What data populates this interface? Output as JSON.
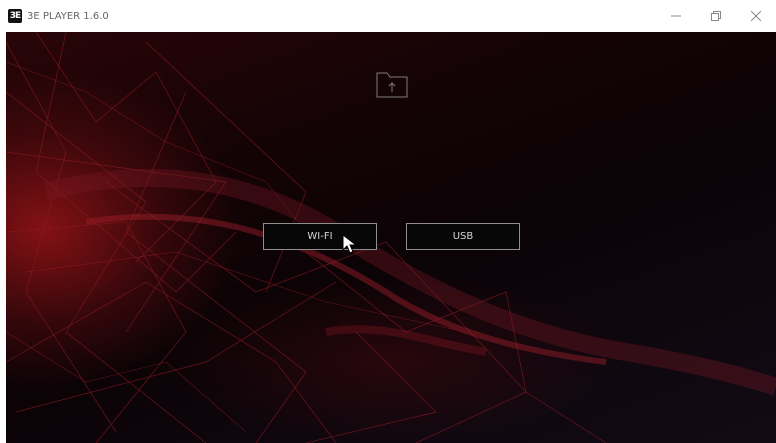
{
  "window": {
    "title": "3E PLAYER 1.6.0",
    "app_icon_glyph": "3E",
    "controls": [
      "minimize-icon",
      "restore-icon",
      "close-icon"
    ]
  },
  "main": {
    "upload_icon": "folder-upload-icon",
    "buttons": {
      "wifi_label": "WI-FI",
      "usb_label": "USB"
    }
  },
  "colors": {
    "accent_red": "#b0161c",
    "background_dark": "#0b0306",
    "button_border": "#8e8e8e"
  }
}
